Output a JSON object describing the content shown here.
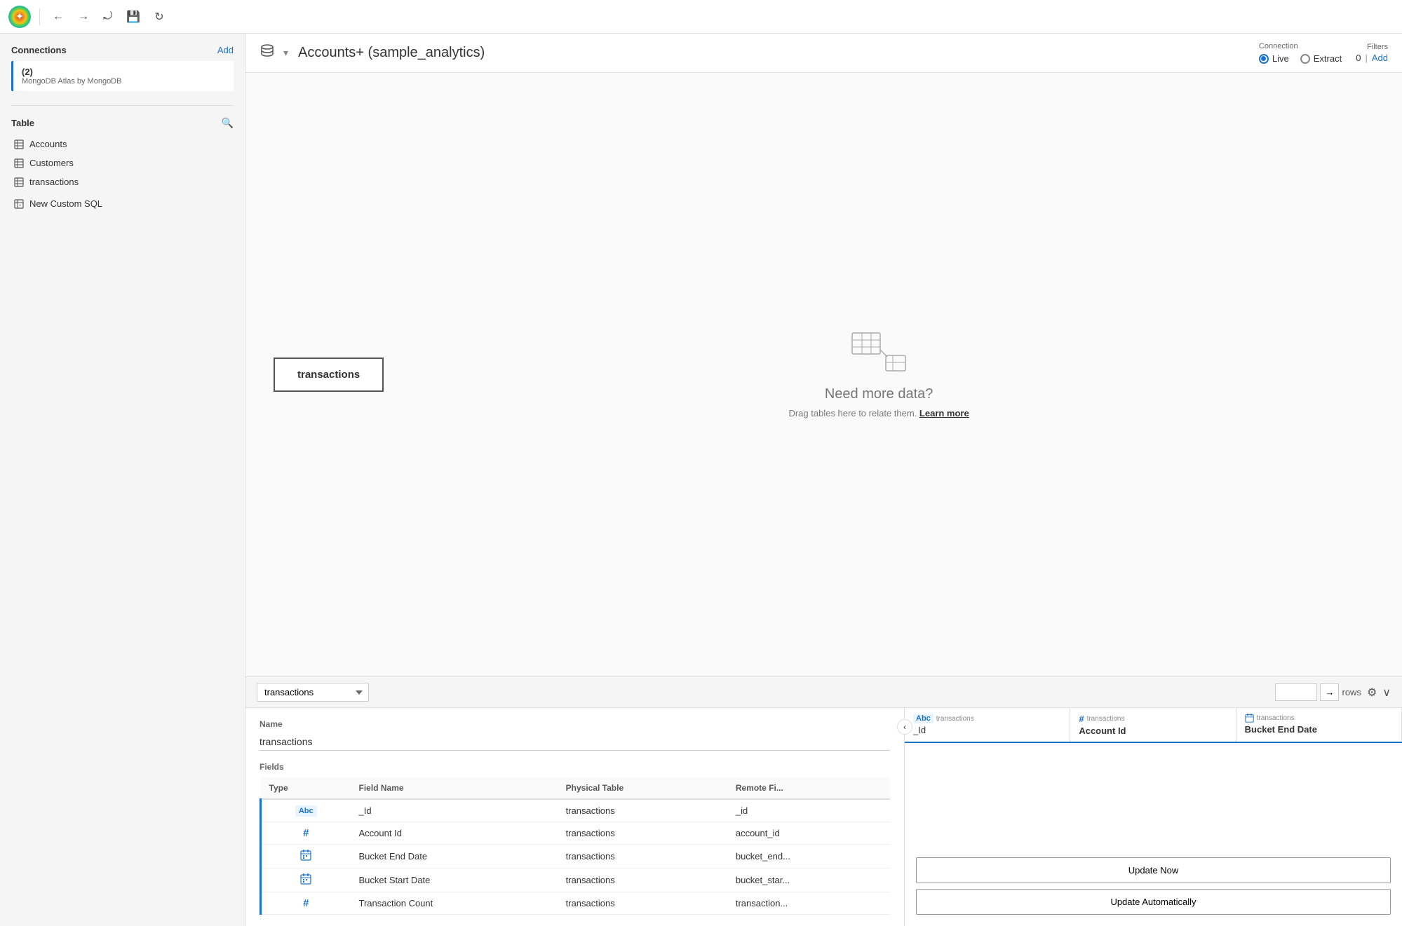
{
  "toolbar": {
    "back_btn": "←",
    "forward_btn": "→",
    "history_btn": "⤾",
    "save_btn": "💾",
    "refresh_btn": "↻"
  },
  "sidebar": {
    "connections_title": "Connections",
    "connections_add": "Add",
    "connection_item": {
      "num": "(2)",
      "name": "MongoDB Atlas by MongoDB"
    },
    "table_title": "Table",
    "tables": [
      {
        "name": "Accounts",
        "type": "grid"
      },
      {
        "name": "Customers",
        "type": "grid"
      },
      {
        "name": "transactions",
        "type": "grid"
      }
    ],
    "custom_sql": "New Custom SQL"
  },
  "header": {
    "db_icon": "🗄",
    "title": "Accounts+ (sample_analytics)",
    "connection_label": "Connection",
    "live_label": "Live",
    "extract_label": "Extract",
    "filters_label": "Filters",
    "filters_count": "0",
    "filters_add": "Add"
  },
  "canvas": {
    "table_card_label": "transactions",
    "need_more_title": "Need more data?",
    "need_more_sub": "Drag tables here to relate them.",
    "learn_more": "Learn more"
  },
  "grid_toolbar": {
    "table_select_value": "transactions",
    "rows_input_value": "",
    "rows_arrow": "→",
    "rows_label": "rows"
  },
  "left_panel": {
    "name_label": "Name",
    "name_value": "transactions",
    "fields_label": "Fields",
    "columns": {
      "type": "Type",
      "field_name": "Field Name",
      "physical_table": "Physical Table",
      "remote_fi": "Remote Fi..."
    },
    "fields": [
      {
        "type": "Abc",
        "field_name": "_Id",
        "physical_table": "transactions",
        "remote_fi": "_id",
        "type_kind": "abc"
      },
      {
        "type": "#",
        "field_name": "Account Id",
        "physical_table": "transactions",
        "remote_fi": "account_id",
        "type_kind": "hash"
      },
      {
        "type": "cal",
        "field_name": "Bucket End Date",
        "physical_table": "transactions",
        "remote_fi": "bucket_end...",
        "type_kind": "cal"
      },
      {
        "type": "cal",
        "field_name": "Bucket Start Date",
        "physical_table": "transactions",
        "remote_fi": "bucket_star...",
        "type_kind": "cal"
      },
      {
        "type": "#",
        "field_name": "Transaction Count",
        "physical_table": "transactions",
        "remote_fi": "transaction...",
        "type_kind": "hash"
      }
    ]
  },
  "right_panel": {
    "columns": [
      {
        "type_label": "Abc",
        "type_icon": "text",
        "source": "transactions",
        "col_name": "_Id",
        "bold": false
      },
      {
        "type_label": "#",
        "type_icon": "hash",
        "source": "transactions",
        "col_name": "Account Id",
        "bold": true
      },
      {
        "type_label": "cal",
        "type_icon": "cal",
        "source": "transactions",
        "col_name": "Bucket End Date",
        "bold": true
      }
    ],
    "update_now": "Update Now",
    "update_auto": "Update Automatically"
  }
}
